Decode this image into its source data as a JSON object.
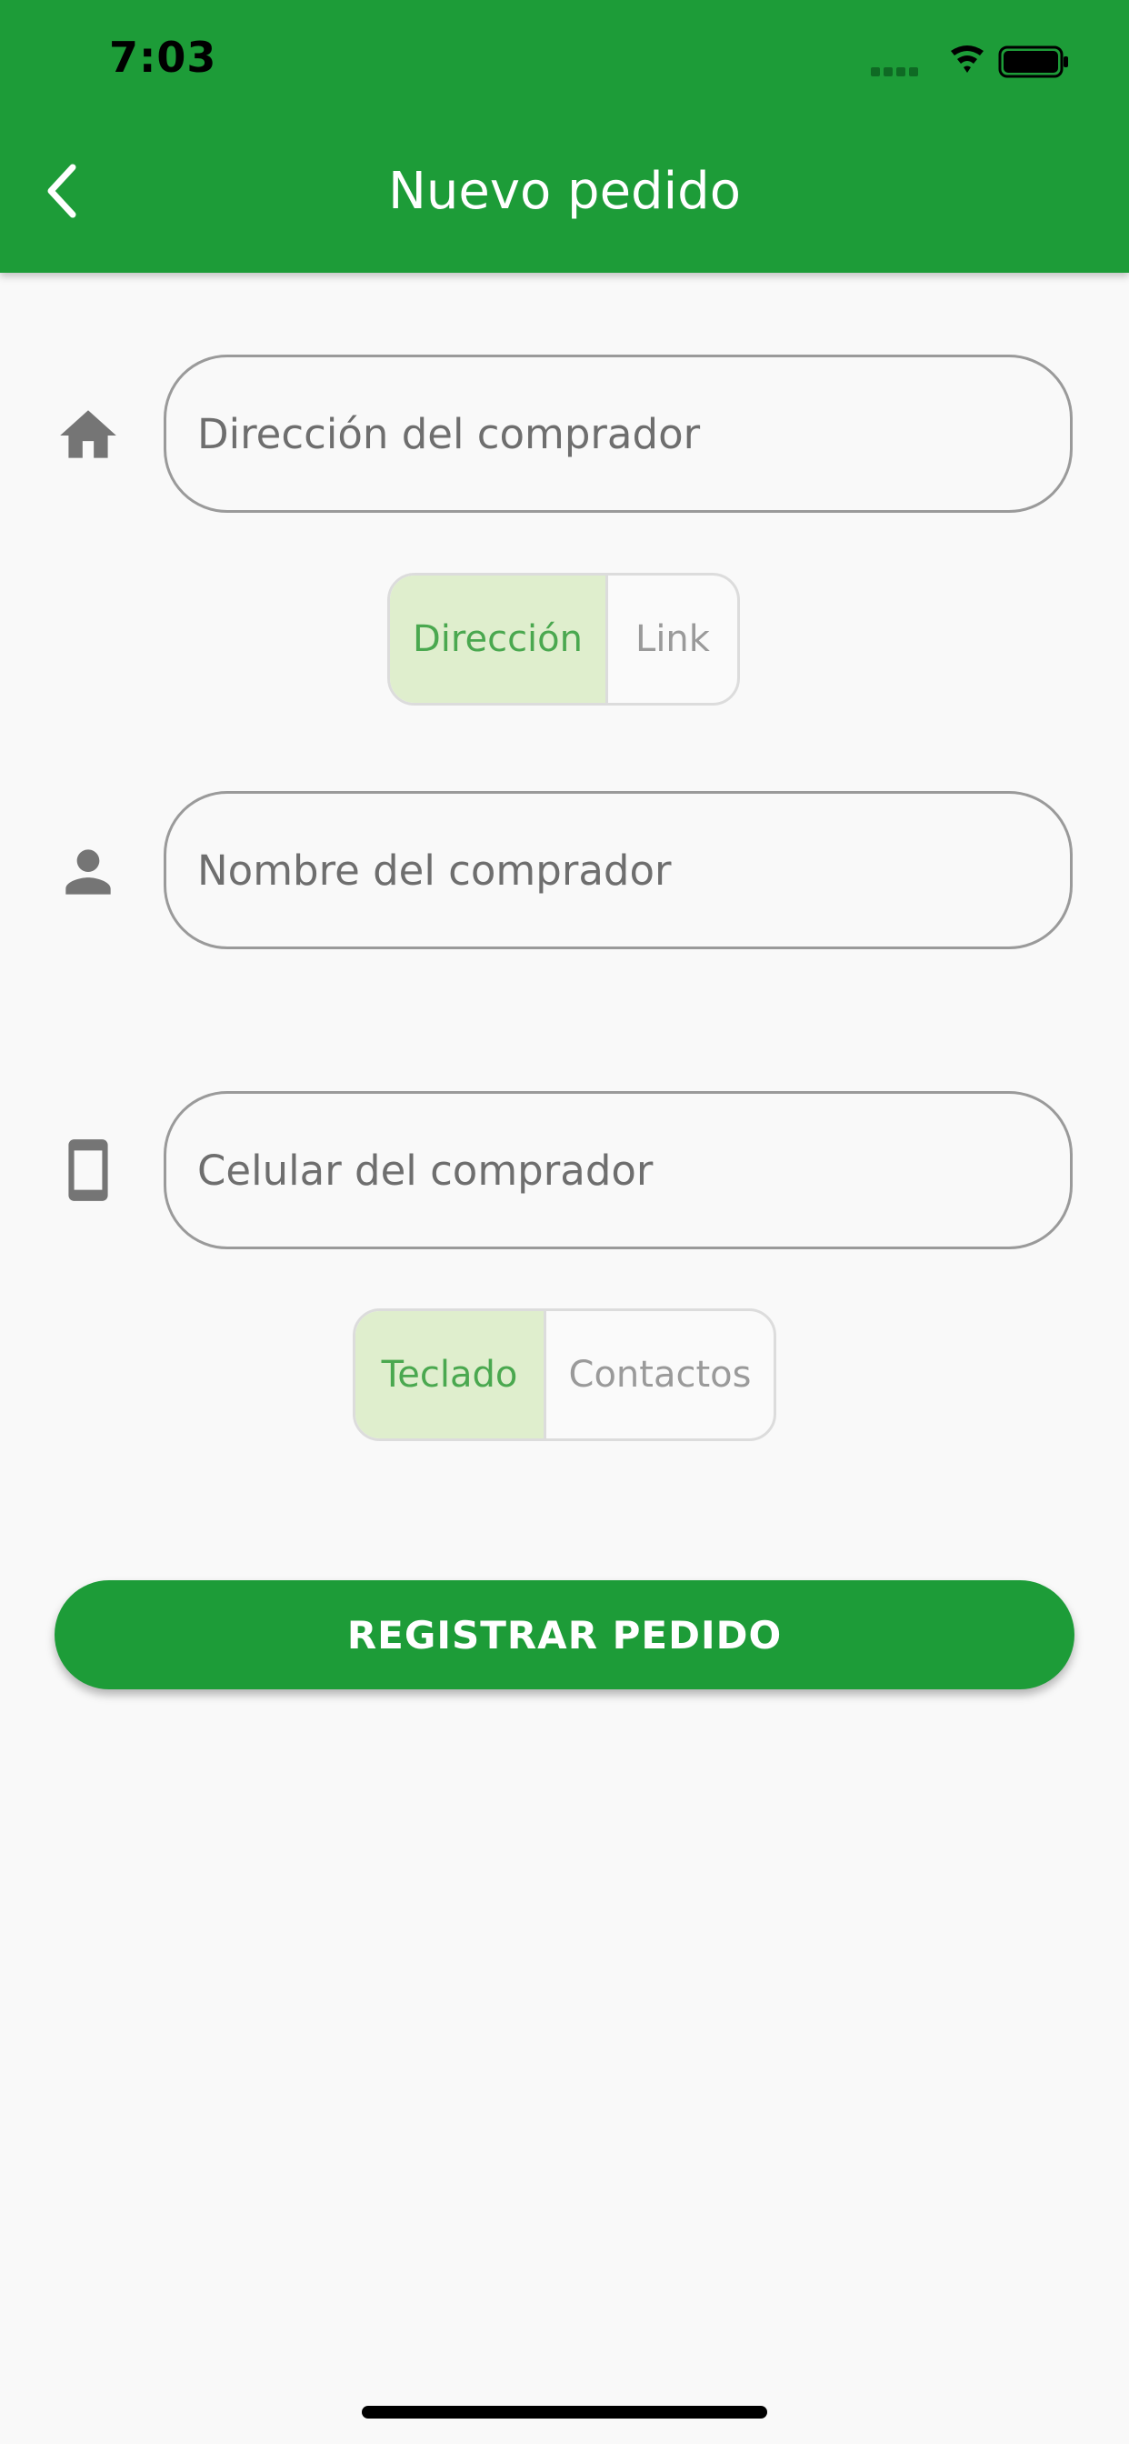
{
  "status_bar": {
    "time": "7:03",
    "icons": [
      "signal-icon",
      "wifi-icon",
      "battery-icon"
    ]
  },
  "header": {
    "title": "Nuevo pedido",
    "back_icon": "chevron-left-icon"
  },
  "form": {
    "address": {
      "icon": "home-icon",
      "placeholder": "Dirección del comprador",
      "value": "",
      "modes": [
        "Dirección",
        "Link"
      ],
      "selected_mode": "Dirección"
    },
    "name": {
      "icon": "person-icon",
      "placeholder": "Nombre del comprador",
      "value": ""
    },
    "phone": {
      "icon": "smartphone-icon",
      "placeholder": "Celular del comprador",
      "value": "",
      "modes": [
        "Teclado",
        "Contactos"
      ],
      "selected_mode": "Teclado"
    },
    "submit_label": "REGISTRAR PEDIDO"
  },
  "colors": {
    "primary": "#1d9c38",
    "segment_active_bg": "#dfeecd",
    "segment_active_text": "#4aa84f",
    "segment_inactive_text": "#9a9a9a",
    "input_border": "#9a9a9a",
    "icon_gray": "#757575",
    "background": "#f9f9f9"
  }
}
